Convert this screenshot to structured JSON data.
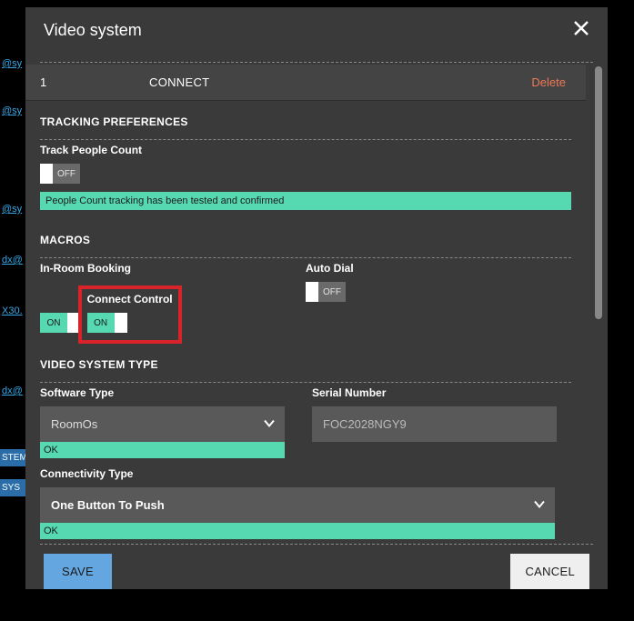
{
  "bg": {
    "items": [
      "@sy",
      "@sy",
      "@sy",
      "dx@",
      "X30.",
      "dx@"
    ],
    "tags": [
      "STEM",
      "SYS"
    ]
  },
  "dialog": {
    "title": "Video system",
    "row": {
      "index": "1",
      "name": "CONNECT",
      "delete_label": "Delete"
    },
    "sections": {
      "tracking_prefs": {
        "title": "TRACKING PREFERENCES",
        "track_people_count_label": "Track People Count",
        "track_people_count_state": "OFF",
        "track_people_count_status": "People Count tracking has been tested and confirmed"
      },
      "macros": {
        "title": "MACROS",
        "in_room_booking_label": "In-Room Booking",
        "in_room_booking_state": "ON",
        "auto_dial_label": "Auto Dial",
        "auto_dial_state": "OFF",
        "connect_control_label": "Connect Control",
        "connect_control_state": "ON"
      },
      "video_system_type": {
        "title": "VIDEO SYSTEM TYPE",
        "software_type_label": "Software Type",
        "software_type_value": "RoomOs",
        "software_type_ok": "OK",
        "serial_number_label": "Serial Number",
        "serial_number_value": "FOC2028NGY9",
        "connectivity_type_label": "Connectivity Type",
        "connectivity_type_value": "One Button To Push",
        "connectivity_type_ok": "OK"
      }
    },
    "footer": {
      "save": "SAVE",
      "cancel": "CANCEL"
    }
  }
}
